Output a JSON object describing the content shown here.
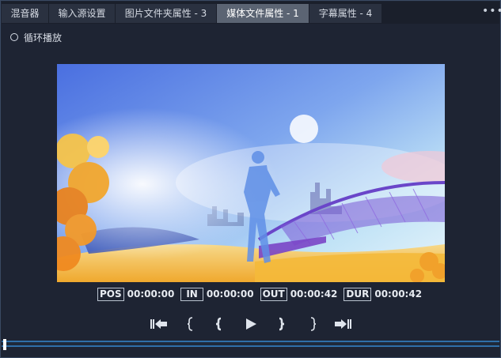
{
  "tabs": [
    {
      "label": "混音器",
      "active": false
    },
    {
      "label": "输入源设置",
      "active": false
    },
    {
      "label": "图片文件夹属性 - 3",
      "active": false
    },
    {
      "label": "媒体文件属性 - 1",
      "active": true
    },
    {
      "label": "字幕属性 - 4",
      "active": false
    }
  ],
  "more_menu_icon": "more-horizontal-icon",
  "loop": {
    "label": "循环播放",
    "checked": false
  },
  "timecodes": {
    "pos_label": "POS",
    "pos_value": "00:00:00",
    "in_label": "IN",
    "in_value": "00:00:00",
    "out_label": "OUT",
    "out_value": "00:00:42",
    "dur_label": "DUR",
    "dur_value": "00:00:42"
  },
  "controls": [
    {
      "name": "go-to-start-icon"
    },
    {
      "name": "set-in-point-icon"
    },
    {
      "name": "step-back-icon"
    },
    {
      "name": "play-icon"
    },
    {
      "name": "step-forward-icon"
    },
    {
      "name": "set-out-point-icon"
    },
    {
      "name": "go-to-end-icon"
    }
  ],
  "timeline": {
    "position": 0.0
  },
  "colors": {
    "background": "#1e2433",
    "active_tab": "#5b6473",
    "timeline_accent": "#2f6fa8"
  }
}
